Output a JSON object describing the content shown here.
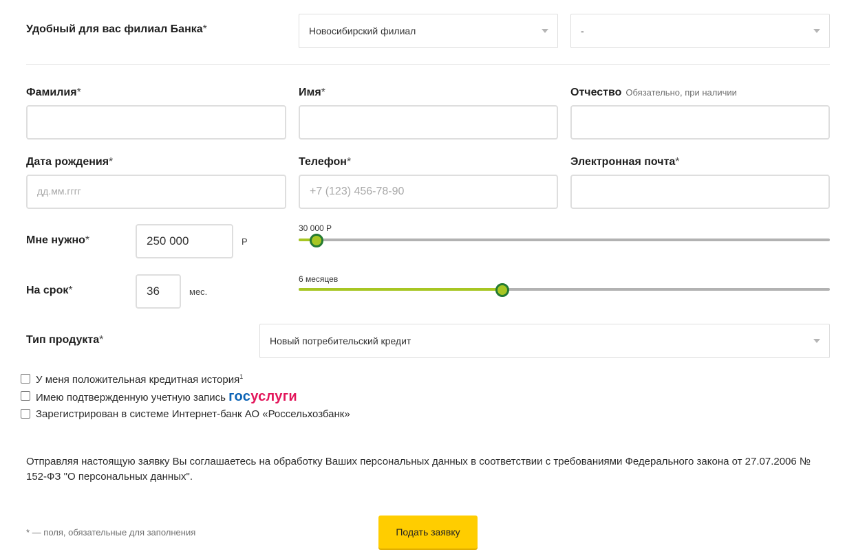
{
  "branch": {
    "label": "Удобный для вас филиал Банка",
    "required_mark": "*",
    "branch_select": "Новосибирский филиал",
    "office_select": "-"
  },
  "fields": {
    "surname": {
      "label": "Фамилия",
      "required_mark": "*",
      "value": ""
    },
    "name": {
      "label": "Имя",
      "required_mark": "*",
      "value": ""
    },
    "patronymic": {
      "label": "Отчество",
      "hint": "Обязательно, при наличии",
      "value": ""
    },
    "birthdate": {
      "label": "Дата рождения",
      "required_mark": "*",
      "placeholder": "дд.мм.гггг"
    },
    "phone": {
      "label": "Телефон",
      "required_mark": "*",
      "placeholder": "+7 (123) 456-78-90"
    },
    "email": {
      "label": "Электронная почта",
      "required_mark": "*",
      "value": ""
    }
  },
  "amount": {
    "label": "Мне нужно",
    "required_mark": "*",
    "value": "250 000",
    "unit": "Р",
    "slider_min_caption": "30 000 Р",
    "slider_position": 0.03
  },
  "term": {
    "label": "На срок",
    "required_mark": "*",
    "value": "36",
    "unit": "мес.",
    "slider_min_caption": "6 месяцев",
    "slider_position": 0.38
  },
  "product": {
    "label": "Тип продукта",
    "required_mark": "*",
    "selected": "Новый потребительский кредит"
  },
  "checkboxes": [
    {
      "text": "У меня положительная кредитная история",
      "sup": "1",
      "checked": false
    },
    {
      "text": "Имею подтвержденную учетную запись",
      "brand_part1": "гос",
      "brand_part2": "услуги",
      "checked": false
    },
    {
      "text": "Зарегистрирован в системе Интернет-банк АО «Россельхозбанк»",
      "checked": false
    }
  ],
  "consent_text": "Отправляя настоящую заявку Вы соглашаетесь на обработку Ваших персональных данных в соответствии с требованиями Федерального закона от 27.07.2006 № 152-ФЗ \"О персональных данных\".",
  "footnote": "* — поля, обязательные для заполнения",
  "submit_label": "Подать заявку",
  "colors": {
    "accent_green": "#a7c623",
    "thumb_border": "#247a32",
    "button_yellow": "#ffcd00",
    "gos_blue": "#0d64b6",
    "gos_red": "#e2155a"
  }
}
